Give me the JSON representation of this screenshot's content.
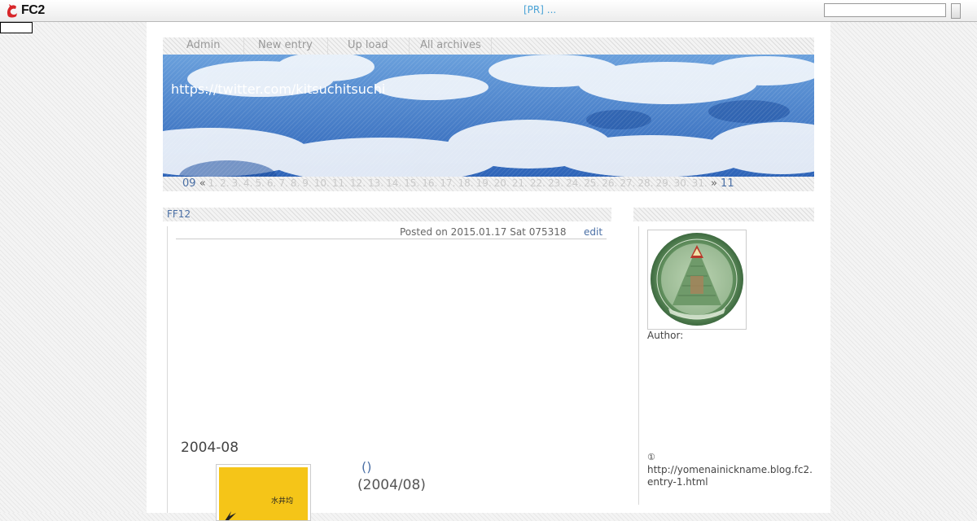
{
  "fc2bar": {
    "logo_text": "FC2",
    "pr_text": "[PR] ...",
    "search_placeholder": ""
  },
  "nav": {
    "items": [
      "Admin",
      "New entry",
      "Up load",
      "All archives"
    ]
  },
  "banner": {
    "site_url": "https://twitter.com/kitsuchitsuchi"
  },
  "calendar": {
    "prev_month": "09",
    "prev_arrow": "«",
    "days": [
      "1.",
      "2.",
      "3.",
      "4.",
      "5.",
      "6.",
      "7.",
      "8.",
      "9.",
      "10.",
      "11.",
      "12.",
      "13.",
      "14.",
      "15.",
      "16.",
      "17.",
      "18.",
      "19.",
      "20.",
      "21.",
      "22.",
      "23.",
      "24.",
      "25.",
      "26.",
      "27.",
      "28.",
      "29.",
      "30.",
      "31."
    ],
    "next_arrow": "»",
    "next_month": "11"
  },
  "entry": {
    "category": "FF12",
    "posted": "Posted on 2015.01.17 Sat 075318",
    "edit_label": "edit",
    "heading": "2004-08",
    "book_author": "水井均",
    "book_link": "()",
    "book_date": "(2004/08)"
  },
  "sidebar": {
    "author_label": "Author:",
    "circled_one": "①",
    "url_text": "http://yomenainickname.blog.fc2.entry-1.html"
  },
  "colors": {
    "link": "#4a6fa5",
    "pr_link": "#4aa3d6",
    "banner_sky": "#3f78c6",
    "book_cover": "#f5c518"
  }
}
